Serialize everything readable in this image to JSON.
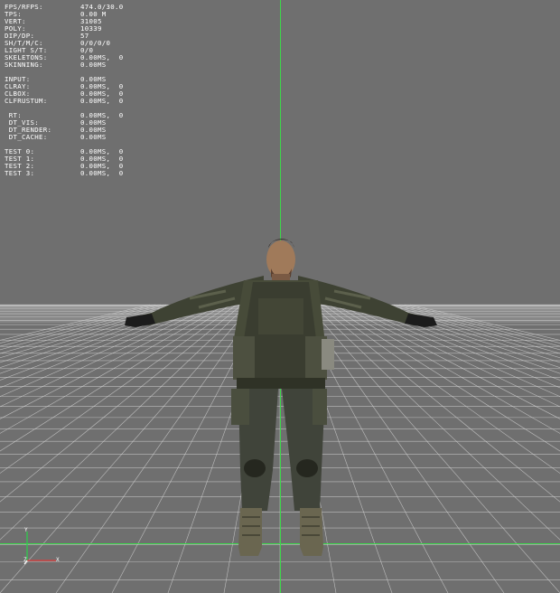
{
  "viewer": {
    "colors": {
      "background": "#6f6f6f",
      "grid": "#d8d8d8",
      "axis_vertical": "#3cd84a",
      "axis_horizontal": "#3cd84a",
      "axis_x": "#e03a3a",
      "axis_y": "#2ad24a",
      "axis_z": "#ffffff"
    },
    "stats_block_1": [
      {
        "label": "FPS/RFPS:",
        "value": "474.0/30.0"
      },
      {
        "label": "TPS:",
        "value": "0.00 M"
      },
      {
        "label": "VERT:",
        "value": "31005"
      },
      {
        "label": "POLY:",
        "value": "10339"
      },
      {
        "label": "DIP/DP:",
        "value": "57"
      },
      {
        "label": "SH/T/M/C:",
        "value": "0/0/0/0"
      },
      {
        "label": "LIGHT S/T:",
        "value": "0/0"
      },
      {
        "label": "SKELETONS:",
        "value": "0.00MS,  0"
      },
      {
        "label": "SKINNING:",
        "value": "0.00MS"
      }
    ],
    "stats_block_2": [
      {
        "label": "INPUT:",
        "value": "0.00MS"
      },
      {
        "label": "CLRAY:",
        "value": "0.00MS,  0"
      },
      {
        "label": "CLBOX:",
        "value": "0.00MS,  0"
      },
      {
        "label": "CLFRUSTUM:",
        "value": "0.00MS,  0"
      }
    ],
    "stats_block_3": [
      {
        "label": " RT:",
        "value": "0.00MS,  0"
      },
      {
        "label": " DT_VIS:",
        "value": "0.00MS"
      },
      {
        "label": " DT_RENDER:",
        "value": "0.00MS"
      },
      {
        "label": " DT_CACHE:",
        "value": "0.00MS"
      }
    ],
    "stats_block_4": [
      {
        "label": "TEST 0:",
        "value": "0.00MS,  0"
      },
      {
        "label": "TEST 1:",
        "value": "0.00MS,  0"
      },
      {
        "label": "TEST 2:",
        "value": "0.00MS,  0"
      },
      {
        "label": "TEST 3:",
        "value": "0.00MS,  0"
      }
    ],
    "gizmo": {
      "y_label": "Y",
      "x_label": "X",
      "z_label": "Z"
    },
    "model_icon": "soldier-model-icon"
  }
}
